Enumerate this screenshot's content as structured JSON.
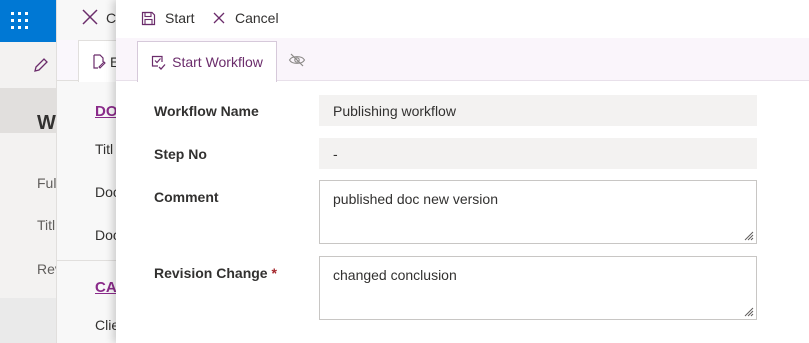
{
  "background_app": {
    "waffle_icon": "waffle-grid-icon",
    "edit_icon": "pencil-icon",
    "heading_partial": "W",
    "fields_partial": [
      "Ful",
      "Titl",
      "Rev"
    ]
  },
  "background_panel": {
    "close_partial": "Cl",
    "tab_partial": "E",
    "section1_partial": "DO",
    "fields1_partial": [
      "Titl",
      "Doc",
      "Doc"
    ],
    "section2_partial": "CA",
    "field2_partial": "Clie"
  },
  "commands": {
    "start_label": "Start",
    "cancel_label": "Cancel"
  },
  "tabs": {
    "active_label": "Start Workflow",
    "hidden_icon": "eye-off-icon"
  },
  "form": {
    "workflow_name_label": "Workflow Name",
    "workflow_name_value": "Publishing workflow",
    "step_no_label": "Step No",
    "step_no_value": "-",
    "comment_label": "Comment",
    "comment_value": "published doc new version",
    "revision_change_label": "Revision Change",
    "required_marker": "*",
    "revision_change_value": "changed conclusion"
  },
  "colors": {
    "brand_blue": "#0078d4",
    "accent_purple": "#6b2c6b",
    "required_red": "#a4262c"
  }
}
